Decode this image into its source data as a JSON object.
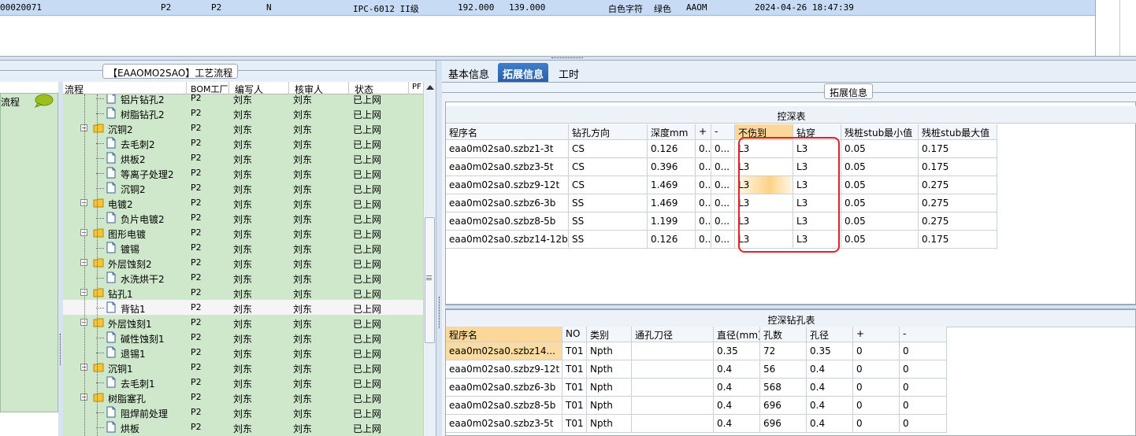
{
  "top_row": {
    "c1": "00020071",
    "c2": "P2",
    "c3": "P2",
    "c4": "N",
    "c5": "IPC-6012 II级",
    "c6": "192.000",
    "c7": "139.000",
    "c8": "白色字符",
    "c9": "绿色",
    "c10": "AAOM",
    "c11": "2024-04-26 18:47:39"
  },
  "left": {
    "title": "【EAAOMO2SAO】工艺流程",
    "nav_label": "流程"
  },
  "tree": {
    "headers": [
      "流程",
      "BOM工厂",
      "编写人",
      "核审人",
      "状态",
      "PF"
    ],
    "rows": [
      {
        "name": "铝片钻孔2",
        "level": 1,
        "factory": "P2",
        "writer": "刘东",
        "reviewer": "刘东",
        "status": "已上网"
      },
      {
        "name": "树脂钻孔2",
        "level": 1,
        "factory": "P2",
        "writer": "刘东",
        "reviewer": "刘东",
        "status": "已上网"
      },
      {
        "name": "沉铜2",
        "level": 0,
        "factory": "P2",
        "writer": "刘东",
        "reviewer": "刘东",
        "status": "已上网"
      },
      {
        "name": "去毛刺2",
        "level": 1,
        "factory": "P2",
        "writer": "刘东",
        "reviewer": "刘东",
        "status": "已上网"
      },
      {
        "name": "烘板2",
        "level": 1,
        "factory": "P2",
        "writer": "刘东",
        "reviewer": "刘东",
        "status": "已上网"
      },
      {
        "name": "等离子处理2",
        "level": 1,
        "factory": "P2",
        "writer": "刘东",
        "reviewer": "刘东",
        "status": "已上网"
      },
      {
        "name": "沉铜2",
        "level": 1,
        "factory": "P2",
        "writer": "刘东",
        "reviewer": "刘东",
        "status": "已上网"
      },
      {
        "name": "电镀2",
        "level": 0,
        "factory": "P2",
        "writer": "刘东",
        "reviewer": "刘东",
        "status": "已上网"
      },
      {
        "name": "负片电镀2",
        "level": 1,
        "factory": "P2",
        "writer": "刘东",
        "reviewer": "刘东",
        "status": "已上网"
      },
      {
        "name": "图形电镀",
        "level": 0,
        "factory": "P2",
        "writer": "刘东",
        "reviewer": "刘东",
        "status": "已上网"
      },
      {
        "name": "镀锡",
        "level": 1,
        "factory": "P2",
        "writer": "刘东",
        "reviewer": "刘东",
        "status": "已上网"
      },
      {
        "name": "外层蚀刻2",
        "level": 0,
        "factory": "P2",
        "writer": "刘东",
        "reviewer": "刘东",
        "status": "已上网"
      },
      {
        "name": "水洗烘干2",
        "level": 1,
        "factory": "P2",
        "writer": "刘东",
        "reviewer": "刘东",
        "status": "已上网"
      },
      {
        "name": "钻孔1",
        "level": 0,
        "factory": "P2",
        "writer": "刘东",
        "reviewer": "刘东",
        "status": "已上网"
      },
      {
        "name": "背钻1",
        "level": 1,
        "factory": "P2",
        "writer": "刘东",
        "reviewer": "刘东",
        "status": "已上网",
        "selected": true
      },
      {
        "name": "外层蚀刻1",
        "level": 0,
        "factory": "P2",
        "writer": "刘东",
        "reviewer": "刘东",
        "status": "已上网"
      },
      {
        "name": "碱性蚀刻1",
        "level": 1,
        "factory": "P2",
        "writer": "刘东",
        "reviewer": "刘东",
        "status": "已上网"
      },
      {
        "name": "退锡1",
        "level": 1,
        "factory": "P2",
        "writer": "刘东",
        "reviewer": "刘东",
        "status": "已上网"
      },
      {
        "name": "沉铜1",
        "level": 0,
        "factory": "P2",
        "writer": "刘东",
        "reviewer": "刘东",
        "status": "已上网"
      },
      {
        "name": "去毛刺1",
        "level": 1,
        "factory": "P2",
        "writer": "刘东",
        "reviewer": "刘东",
        "status": "已上网"
      },
      {
        "name": "树脂塞孔",
        "level": 0,
        "factory": "P2",
        "writer": "刘东",
        "reviewer": "刘东",
        "status": "已上网"
      },
      {
        "name": "阻焊前处理",
        "level": 1,
        "factory": "P2",
        "writer": "刘东",
        "reviewer": "刘东",
        "status": "已上网"
      },
      {
        "name": "烘板",
        "level": 1,
        "factory": "P2",
        "writer": "刘东",
        "reviewer": "刘东",
        "status": "已上网"
      }
    ]
  },
  "tabs": [
    "基本信息",
    "拓展信息",
    "工时"
  ],
  "ext_title": "拓展信息",
  "depth_table": {
    "title": "控深表",
    "headers": [
      "程序名",
      "钻孔方向",
      "深度mm",
      "+",
      "-",
      "不伤到",
      "钻穿",
      "残桩stub最小值",
      "残桩stub最大值"
    ],
    "rows": [
      [
        "eaa0m02sa0.szbz1-3t",
        "CS",
        "0.126",
        "0...",
        "0...",
        "L3",
        "L3",
        "0.05",
        "0.175"
      ],
      [
        "eaa0m02sa0.szbz3-5t",
        "CS",
        "0.396",
        "0...",
        "0...",
        "L3",
        "L3",
        "0.05",
        "0.175"
      ],
      [
        "eaa0m02sa0.szbz9-12t",
        "CS",
        "1.469",
        "0...",
        "0...",
        "L3",
        "L3",
        "0.05",
        "0.275"
      ],
      [
        "eaa0m02sa0.szbz6-3b",
        "SS",
        "1.469",
        "0...",
        "0...",
        "L3",
        "L3",
        "0.05",
        "0.275"
      ],
      [
        "eaa0m02sa0.szbz8-5b",
        "SS",
        "1.199",
        "0...",
        "0...",
        "L3",
        "L3",
        "0.05",
        "0.275"
      ],
      [
        "eaa0m02sa0.szbz14-12b",
        "SS",
        "0.126",
        "0...",
        "0...",
        "L3",
        "L3",
        "0.05",
        "0.175"
      ]
    ]
  },
  "hole_table": {
    "title": "控深钻孔表",
    "headers": [
      "程序名",
      "NO",
      "类别",
      "通孔刀径",
      "直径(mm)",
      "孔数",
      "孔径",
      "+",
      "-"
    ],
    "rows": [
      [
        "eaa0m02sa0.szbz14...",
        "T01",
        "Npth",
        "",
        "0.35",
        "72",
        "0.35",
        "0",
        "0"
      ],
      [
        "eaa0m02sa0.szbz9-12t",
        "T01",
        "Npth",
        "",
        "0.4",
        "56",
        "0.4",
        "0",
        "0"
      ],
      [
        "eaa0m02sa0.szbz6-3b",
        "T01",
        "Npth",
        "",
        "0.4",
        "568",
        "0.4",
        "0",
        "0"
      ],
      [
        "eaa0m02sa0.szbz8-5b",
        "T01",
        "Npth",
        "",
        "0.4",
        "696",
        "0.4",
        "0",
        "0"
      ],
      [
        "eaa0m02sa0.szbz3-5t",
        "T01",
        "Npth",
        "",
        "0.4",
        "696",
        "0.4",
        "0",
        "0"
      ]
    ]
  },
  "colors": {
    "tree_bg": "#cfe8cc",
    "selected_header": "#fbd79a",
    "highlight_box": "#e0232b",
    "tab_active": "#2f6bb8"
  }
}
